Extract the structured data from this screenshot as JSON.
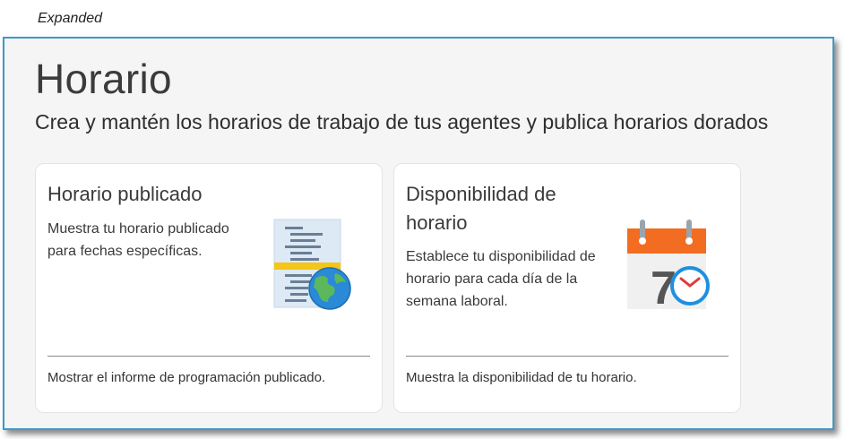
{
  "caption": "Expanded",
  "header": {
    "title": "Horario",
    "subtitle": "Crea y mantén los horarios de trabajo de tus agentes y publica horarios dorados"
  },
  "cards": [
    {
      "title": "Horario publicado",
      "description": "Muestra tu horario publicado para fechas específicas.",
      "footer_link": "Mostrar el informe de programación publicado.",
      "icon": "published-schedule-icon"
    },
    {
      "title": "Disponibilidad de horario",
      "description": "Establece tu disponibilidad de horario para cada día de la semana laboral.",
      "footer_link": "Muestra la disponibilidad de tu horario.",
      "icon": "schedule-availability-icon"
    }
  ],
  "calendar_icon_number": "7",
  "colors": {
    "frame_border": "#3a9bc8",
    "calendar_header": "#f26d21",
    "clock_blue": "#1e90e0"
  }
}
